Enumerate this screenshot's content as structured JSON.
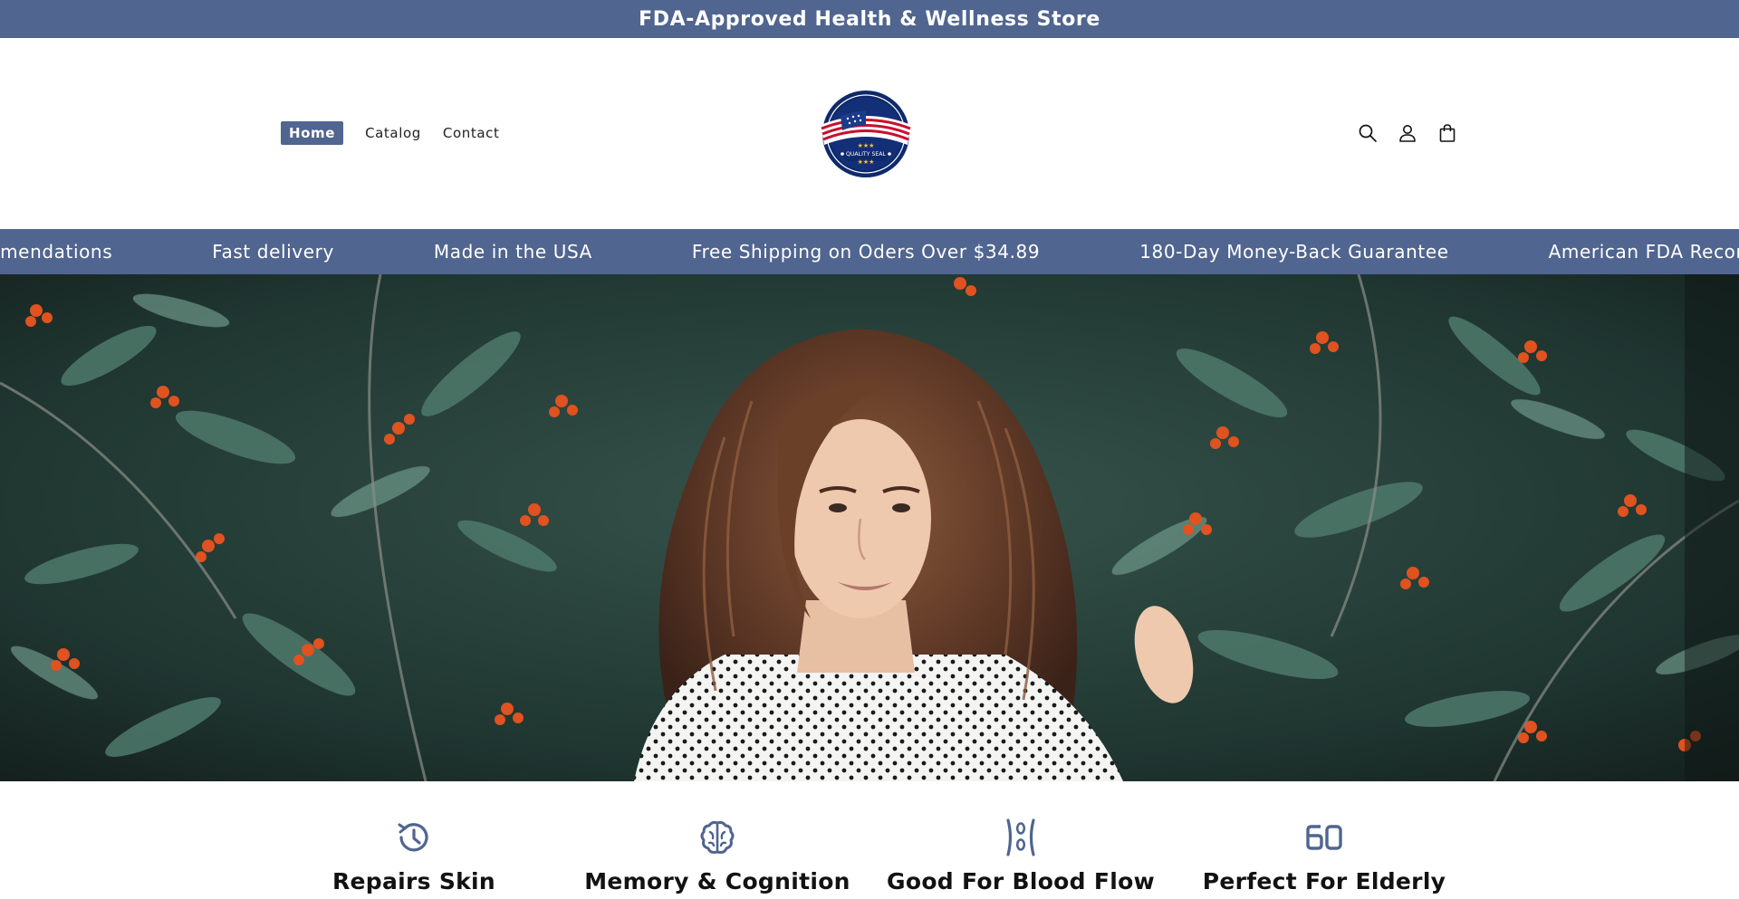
{
  "announcement": {
    "text": "FDA-Approved Health & Wellness Store"
  },
  "nav": {
    "items": [
      {
        "label": "Home",
        "active": true
      },
      {
        "label": "Catalog",
        "active": false
      },
      {
        "label": "Contact",
        "active": false
      }
    ]
  },
  "logo": {
    "alt": "Proudly Made in the USA Quality Seal",
    "seal_text": "QUALITY SEAL"
  },
  "header_icons": [
    "search-icon",
    "account-icon",
    "cart-icon"
  ],
  "marquee": {
    "items": [
      "mmendations",
      "Fast delivery",
      "Made in the USA",
      "Free Shipping on Oders Over $34.89",
      "180-Day Money-Back Guarantee",
      "American FDA Recomme"
    ]
  },
  "hero": {
    "image": "woman-with-curly-hair-in-front-of-rowan-berry-bush"
  },
  "features": [
    {
      "icon": "history-clock-icon",
      "title": "Repairs Skin"
    },
    {
      "icon": "brain-icon",
      "title": "Memory & Cognition"
    },
    {
      "icon": "blood-flow-icon",
      "title": "Good For Blood Flow"
    },
    {
      "icon": "age-60-icon",
      "title": "Perfect For Elderly"
    }
  ],
  "colors": {
    "brand": "#50658f",
    "text": "#121212",
    "background": "#ffffff"
  }
}
